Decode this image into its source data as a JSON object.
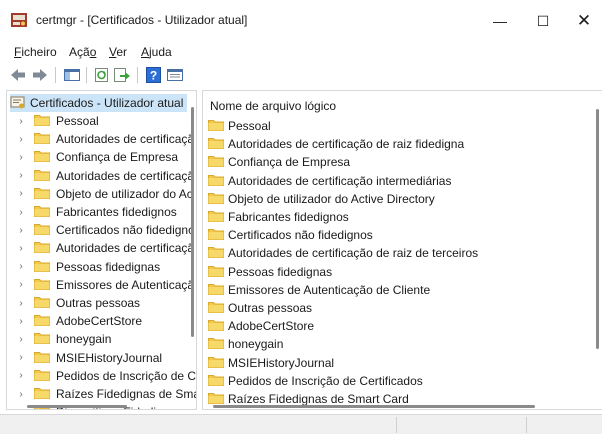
{
  "window": {
    "title": "certmgr - [Certificados - Utilizador atual]",
    "minimize_glyph": "—",
    "maximize_glyph": "☐",
    "close_glyph": "✕"
  },
  "menu": [
    {
      "key": "F",
      "rest": "icheiro"
    },
    {
      "key": "",
      "pre": "Açã",
      "keyEnd": "o"
    },
    {
      "key": "V",
      "rest": "er"
    },
    {
      "key": "A",
      "rest": "juda"
    }
  ],
  "menu_labels": {
    "ficheiro_key": "F",
    "ficheiro_rest": "icheiro",
    "acao_pre": "Açã",
    "acao_key": "o",
    "ver_key": "V",
    "ver_rest": "er",
    "ajuda_key": "A",
    "ajuda_rest": "juda"
  },
  "toolbar": {
    "icons": [
      "back-icon",
      "forward-icon",
      "show-hide-tree-icon",
      "refresh-icon",
      "export-list-icon",
      "help-icon",
      "properties-icon"
    ]
  },
  "tree": {
    "root_label": "Certificados - Utilizador atual",
    "items": [
      "Pessoal",
      "Autoridades de certificaçã",
      "Confiança de Empresa",
      "Autoridades de certificaçã",
      "Objeto de utilizador do Ac",
      "Fabricantes fidedignos",
      "Certificados não fidedignc",
      "Autoridades de certificaçã",
      "Pessoas fidedignas",
      "Emissores de Autenticaçã",
      "Outras pessoas",
      "AdobeCertStore",
      "honeygain",
      "MSIEHistoryJournal",
      "Pedidos de Inscrição de Ce",
      "Raízes Fidedignas de Smar",
      "Dispositivos Fidedignos"
    ]
  },
  "list": {
    "column_header": "Nome de arquivo lógico",
    "items": [
      "Pessoal",
      "Autoridades de certificação de raiz fidedigna",
      "Confiança de Empresa",
      "Autoridades de certificação intermediárias",
      "Objeto de utilizador do Active Directory",
      "Fabricantes fidedignos",
      "Certificados não fidedignos",
      "Autoridades de certificação de raiz de terceiros",
      "Pessoas fidedignas",
      "Emissores de Autenticação de Cliente",
      "Outras pessoas",
      "AdobeCertStore",
      "honeygain",
      "MSIEHistoryJournal",
      "Pedidos de Inscrição de Certificados",
      "Raízes Fidedignas de Smart Card"
    ]
  },
  "colors": {
    "folder": "#f2c94c",
    "folder_dark": "#d9a92a",
    "selection": "#cce4f7",
    "help_blue": "#2b6fd6"
  }
}
